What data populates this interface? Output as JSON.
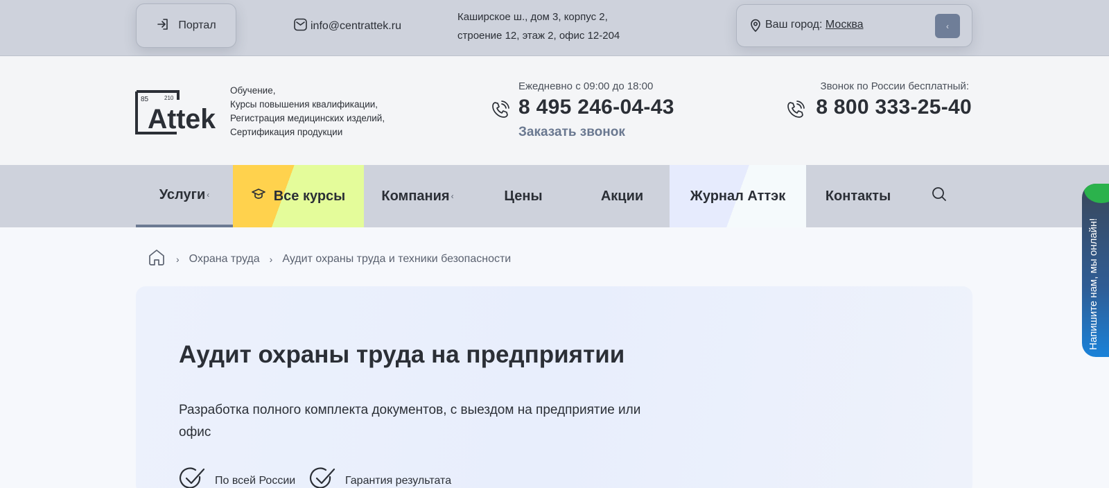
{
  "topbar": {
    "portal_label": "Портал",
    "email": "info@centrattek.ru",
    "address_line1": "Каширское ш., дом 3, корпус 2,",
    "address_line2": "строение 12, этаж 2, офис 12-204",
    "city_prefix": "Ваш город:",
    "city": "Москва"
  },
  "header": {
    "logo_num_left": "85",
    "logo_num_right": "210",
    "logo_text": "Attek",
    "tagline": [
      "Обучение,",
      "Курсы повышения квалификации,",
      "Регистрация медицинских изделий,",
      "Сертификация продукции"
    ],
    "hours": "Ежедневно с 09:00 до 18:00",
    "phone_moscow": "8 495 246-04-43",
    "callback": "Заказать звонок",
    "free_call_label": "Звонок по России бесплатный:",
    "phone_russia": "8 800 333-25-40"
  },
  "nav": {
    "services": "Услуги",
    "all_courses": "Все курсы",
    "company": "Компания",
    "prices": "Цены",
    "promos": "Акции",
    "journal": "Журнал Аттэк",
    "contacts": "Контакты"
  },
  "breadcrumb": {
    "items": [
      "Охрана труда",
      "Аудит охраны труда и техники безопасности"
    ]
  },
  "hero": {
    "title": "Аудит охраны труда на предприятии",
    "subtitle": "Разработка полного комплекта документов, с выездом на предприятие или офис",
    "features": [
      "По всей России",
      "Гарантия результата"
    ]
  },
  "chat_widget": {
    "text": "Напишите нам, мы онлайн!"
  },
  "colors": {
    "topbar_bg": "#ced2dc",
    "header_bg": "#f4f5f7",
    "accent_slate": "#6c7a93",
    "courses_yellow": "#ffd24d",
    "courses_lime": "#e4fc9a",
    "chat_blue": "#1a82d9",
    "chat_green": "#2bb24c"
  }
}
